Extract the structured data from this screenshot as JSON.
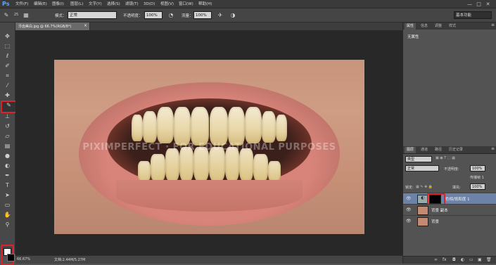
{
  "app": {
    "logo": "Ps",
    "menu": [
      "文件(F)",
      "编辑(E)",
      "图像(I)",
      "图层(L)",
      "文字(Y)",
      "选择(S)",
      "滤镜(T)",
      "3D(D)",
      "视图(V)",
      "窗口(W)",
      "帮助(H)"
    ],
    "window_controls": [
      "—",
      "□",
      "✕"
    ]
  },
  "options_bar": {
    "brush_size": "25",
    "mode_label": "模式：",
    "mode_value": "正常",
    "opacity_label": "不透明度：",
    "opacity_value": "100%",
    "flow_label": "流量：",
    "flow_value": "100%",
    "workspace": "基本功能"
  },
  "document": {
    "tab_label": "牙齿美白.jpg @ 66.7%(RGB/8*)",
    "tab_close": "×",
    "watermark": "PIXIMPERFECT · FOR EDUCATIONAL PURPOSES"
  },
  "status_bar": {
    "zoom": "66.67%",
    "doc_info": "文档:2.44M/5.27M"
  },
  "properties_panel": {
    "tabs": [
      "属性",
      "信息",
      "调整",
      "样式"
    ],
    "content": "无属性"
  },
  "layers_panel": {
    "tabs": [
      "图层",
      "通道",
      "路径",
      "历史记录"
    ],
    "filter_kind": "类型",
    "blend_mode": "正常",
    "opacity_label": "不透明度:",
    "opacity_value": "100%",
    "lock_label": "锁定:",
    "fill_label": "填充:",
    "fill_value": "100%",
    "unify_label": "传播帧 1",
    "layers": [
      {
        "name": "色相/饱和度 1",
        "active": true
      },
      {
        "name": "背景 副本",
        "active": false
      },
      {
        "name": "背景",
        "active": false
      }
    ]
  },
  "colors": {
    "highlight_red": "#e0202a",
    "active_layer": "#6b83a9",
    "foreground": "#ffffff",
    "background": "#000000"
  }
}
